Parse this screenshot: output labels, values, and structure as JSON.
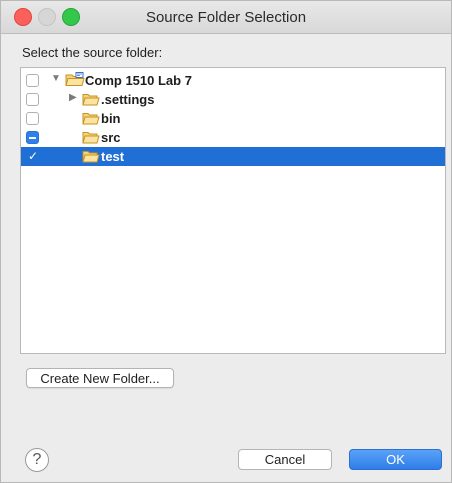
{
  "window": {
    "title": "Source Folder Selection"
  },
  "prompt": "Select the source folder:",
  "tree": {
    "items": [
      {
        "label": "Comp 1510 Lab 7",
        "check": "unchecked",
        "expanded": true,
        "icon": "project-folder-icon"
      },
      {
        "label": ".settings",
        "check": "unchecked",
        "expanded": false,
        "icon": "folder-icon"
      },
      {
        "label": "bin",
        "check": "unchecked",
        "icon": "folder-icon"
      },
      {
        "label": "src",
        "check": "partial",
        "icon": "folder-icon"
      },
      {
        "label": "test",
        "check": "checked",
        "selected": true,
        "icon": "folder-icon"
      }
    ]
  },
  "buttons": {
    "create_folder": "Create New Folder...",
    "cancel": "Cancel",
    "ok": "OK",
    "help": "?"
  },
  "colors": {
    "selection": "#1f6fd6",
    "accent": "#2f7de9",
    "folder": "#f4b942"
  }
}
